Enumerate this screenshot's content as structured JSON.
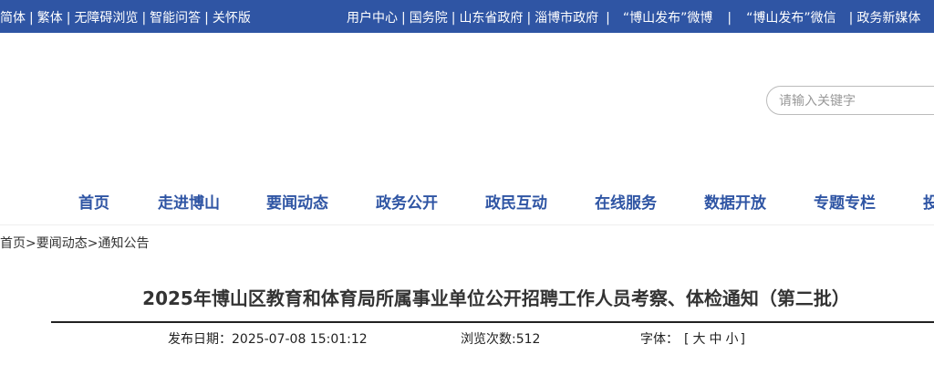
{
  "topbar": {
    "left_links": [
      "简体",
      "繁体",
      "无障碍浏览",
      "智能问答",
      "关怀版"
    ],
    "right_links": [
      "用户中心",
      "国务院",
      "山东省政府",
      "淄博市政府",
      "“博山发布”微博",
      "“博山发布”微信",
      "政务新媒体"
    ]
  },
  "search": {
    "placeholder": "请输入关键字"
  },
  "nav": {
    "items": [
      "首页",
      "走进博山",
      "要闻动态",
      "政务公开",
      "政民互动",
      "在线服务",
      "数据开放",
      "专题专栏",
      "投"
    ]
  },
  "breadcrumb": {
    "home": "首页",
    "sep": ">",
    "level1": "要闻动态",
    "level2": "通知公告"
  },
  "article": {
    "title": "2025年博山区教育和体育局所属事业单位公开招聘工作人员考察、体检通知（第二批）",
    "publish_label": "发布日期：",
    "publish_date": "2025-07-08 15:01:12",
    "views_label": "浏览次数:",
    "views": "512",
    "font_label": "字体：",
    "font_open": "[",
    "font_large": "大",
    "font_medium": "中",
    "font_small": "小",
    "font_close": "]"
  },
  "colors": {
    "brand_blue": "#2f55a4",
    "text": "#333333"
  }
}
